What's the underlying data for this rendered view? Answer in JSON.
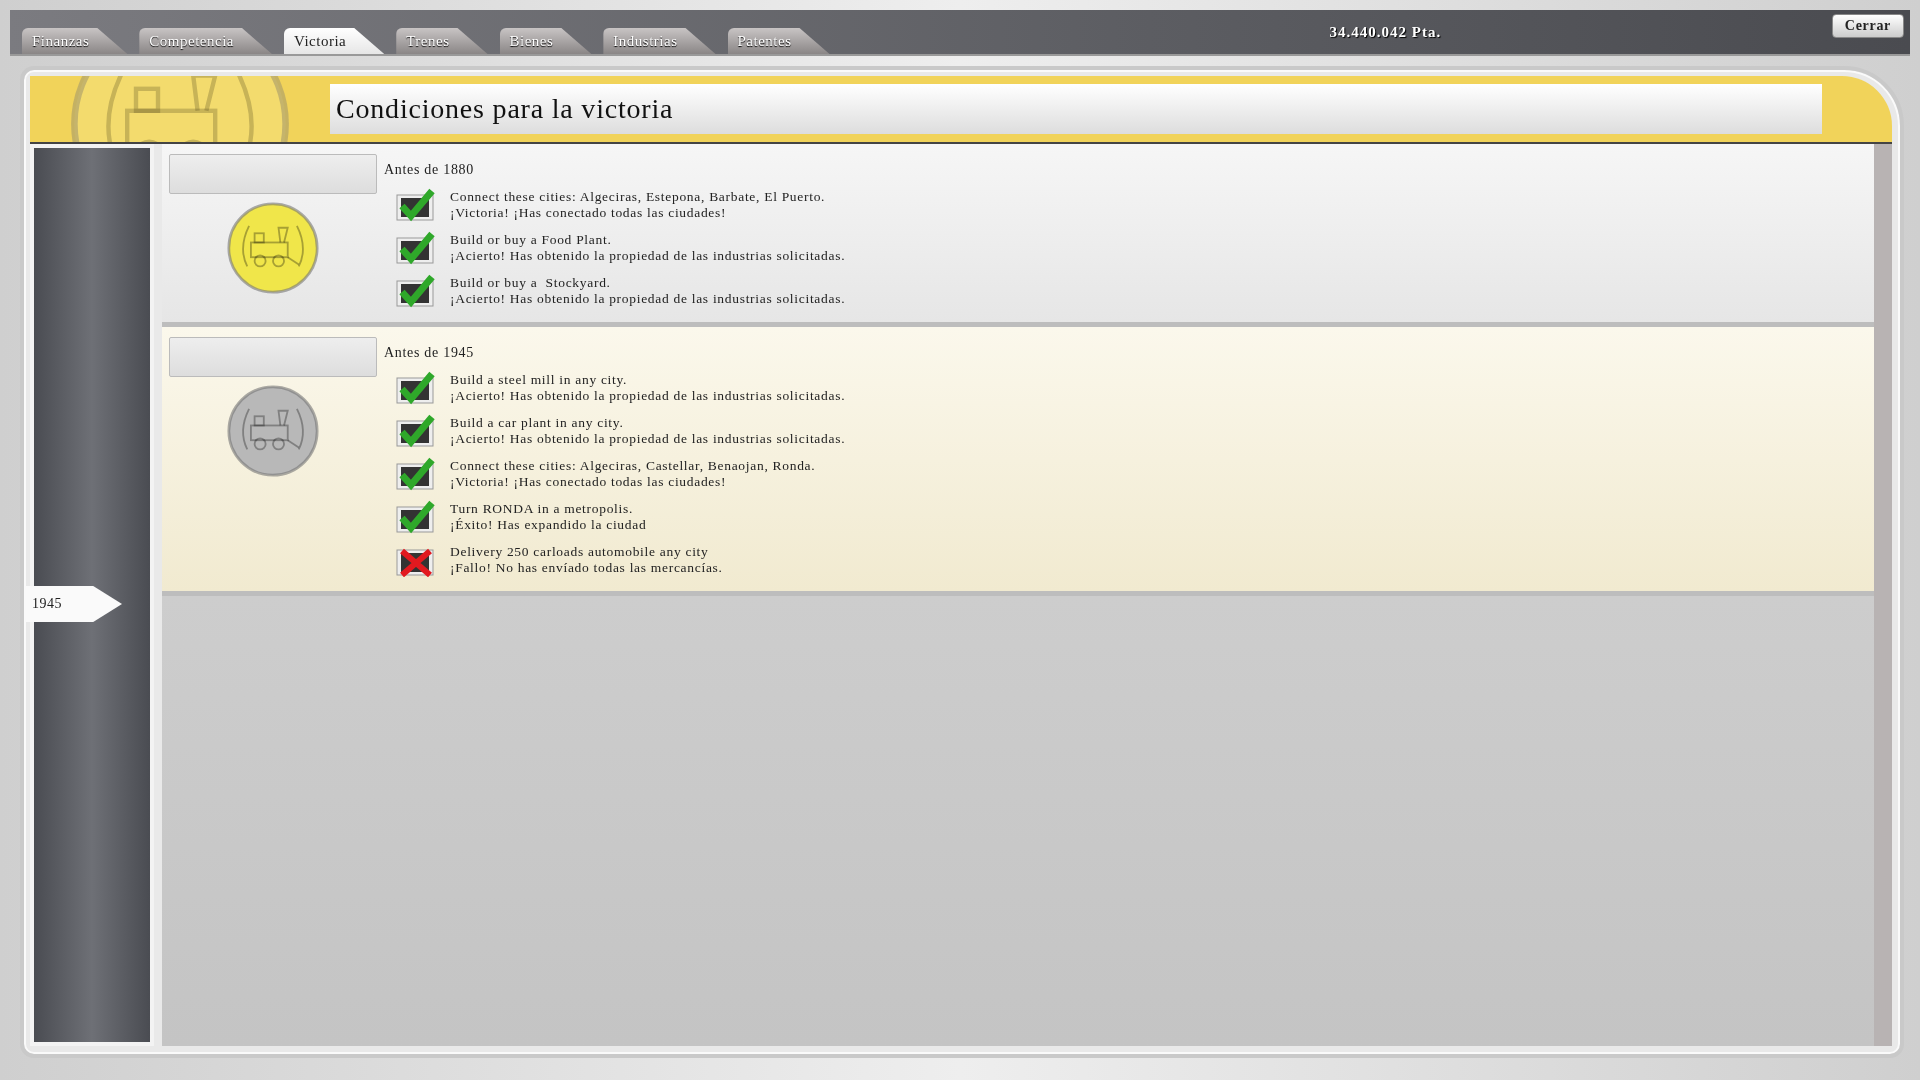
{
  "tabs": [
    {
      "label": "Finanzas",
      "selected": false
    },
    {
      "label": "Competencia",
      "selected": false
    },
    {
      "label": "Victoria",
      "selected": true
    },
    {
      "label": "Trenes",
      "selected": false
    },
    {
      "label": "Bienes",
      "selected": false
    },
    {
      "label": "Industrias",
      "selected": false
    },
    {
      "label": "Patentes",
      "selected": false
    }
  ],
  "money": "34.440.042 Pta.",
  "close_button": "Cerrar",
  "title": "Condiciones para la victoria",
  "timeline_marker": "1945",
  "sections": [
    {
      "heading": "Antes de 1880",
      "color": "#f0e64a",
      "highlighted": false,
      "conditions": [
        {
          "goal": "Connect these cities: Algeciras, Estepona, Barbate, El Puerto.",
          "result": "¡Victoria! ¡Has conectado todas las ciudades!",
          "met": true
        },
        {
          "goal": "Build or buy a Food Plant.",
          "result": "¡Acierto! Has obtenido la propiedad de las industrias solicitadas.",
          "met": true
        },
        {
          "goal": "Build or buy a  Stockyard.",
          "result": "¡Acierto! Has obtenido la propiedad de las industrias solicitadas.",
          "met": true
        }
      ]
    },
    {
      "heading": "Antes de 1945",
      "color": "#b8b8b8",
      "highlighted": true,
      "conditions": [
        {
          "goal": "Build a steel mill in any city.",
          "result": "¡Acierto! Has obtenido la propiedad de las industrias solicitadas.",
          "met": true
        },
        {
          "goal": "Build a car plant in any city.",
          "result": "¡Acierto! Has obtenido la propiedad de las industrias solicitadas.",
          "met": true
        },
        {
          "goal": "Connect these cities: Algeciras, Castellar, Benaojan, Ronda.",
          "result": "¡Victoria! ¡Has conectado todas las ciudades!",
          "met": true
        },
        {
          "goal": "Turn RONDA in a metropolis.",
          "result": "¡Éxito! Has expandido la ciudad",
          "met": true
        },
        {
          "goal": "Delivery 250 carloads automobile any city",
          "result": "¡Fallo! No has envíado todas las mercancías.",
          "met": false
        }
      ]
    }
  ]
}
